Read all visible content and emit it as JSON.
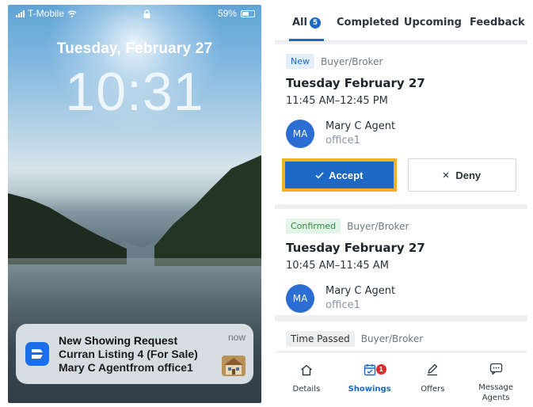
{
  "lock_screen": {
    "status": {
      "carrier": "T-Mobile",
      "battery": "59%"
    },
    "date": "Tuesday, February 27",
    "time": "10:31",
    "notification": {
      "title": "New Showing Request",
      "line1": "Curran Listing 4 (For Sale)",
      "line2": "Mary C Agentfrom office1",
      "time": "now"
    }
  },
  "app": {
    "tabs": [
      {
        "label": "All",
        "badge": "5"
      },
      {
        "label": "Completed"
      },
      {
        "label": "Upcoming"
      },
      {
        "label": "Feedback"
      }
    ],
    "cards": [
      {
        "status": "New",
        "type": "Buyer/Broker",
        "date": "Tuesday February 27",
        "time": "11:45 AM–12:45 PM",
        "agent": {
          "initials": "MA",
          "name": "Mary C Agent",
          "office": "office1"
        },
        "accept_label": "Accept",
        "deny_label": "Deny"
      },
      {
        "status": "Confirmed",
        "type": "Buyer/Broker",
        "date": "Tuesday February 27",
        "time": "10:45 AM–11:45 AM",
        "agent": {
          "initials": "MA",
          "name": "Mary C Agent",
          "office": "office1"
        }
      },
      {
        "status": "Time Passed",
        "type": "Buyer/Broker"
      }
    ],
    "bottom_nav": [
      {
        "label": "Details",
        "icon": "home-icon"
      },
      {
        "label": "Showings",
        "icon": "calendar-icon",
        "badge": "1",
        "active": true
      },
      {
        "label": "Offers",
        "icon": "pen-icon"
      },
      {
        "label": "Message\nAgents",
        "icon": "message-icon"
      }
    ],
    "colors": {
      "primary": "#1c68c5",
      "highlight": "#f2b125",
      "badge_red": "#e02b2b"
    }
  }
}
